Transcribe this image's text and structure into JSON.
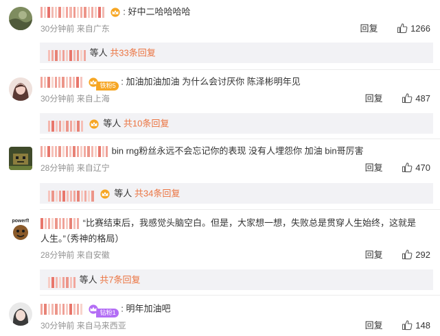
{
  "comments": [
    {
      "text": "好中二哈哈哈哈",
      "colon": ":",
      "time": "30分钟前",
      "location": "来自广东",
      "reply_label": "回复",
      "likes": "1266",
      "replies": {
        "dengren": "等人",
        "count": "共33条回复"
      }
    },
    {
      "text": "加油加油加油 为什么会讨厌你 陈泽彬明年见",
      "colon": ":",
      "badge": "铁粉5",
      "time": "30分钟前",
      "location": "来自上海",
      "reply_label": "回复",
      "likes": "487",
      "replies": {
        "dengren": "等人",
        "count": "共10条回复"
      }
    },
    {
      "text": "bin rng粉丝永远不会忘记你的表现 没有人埋怨你 加油 bin哥厉害",
      "time": "28分钟前",
      "location": "来自辽宁",
      "reply_label": "回复",
      "likes": "470",
      "replies": {
        "dengren": "等人",
        "count": "共34条回复"
      }
    },
    {
      "text_line1": "“比赛结束后，我感觉头脑空白。但是，大家想一想，失败总是贯穿人生始终，这就是",
      "text_line2": "人生。”（秀神的格局）",
      "time": "28分钟前",
      "location": "来自安徽",
      "reply_label": "回复",
      "likes": "292",
      "replies": {
        "dengren": "等人",
        "count": "共7条回复"
      }
    },
    {
      "text": "明年加油吧",
      "colon": ":",
      "badge": "钻粉1",
      "time": "30分钟前",
      "location": "来自马来西亚",
      "reply_label": "回复",
      "likes": "148"
    }
  ],
  "avatar_caption": "powerf!",
  "colors": {
    "accent_orange": "#eb7340",
    "meta_gray": "#939393",
    "reply_bg": "#f2f2f5",
    "badge_orange": "#f6a623",
    "badge_purple": "#b36df5"
  },
  "icons": {
    "like": "thumb-up-icon",
    "vip": "crown-icon"
  }
}
